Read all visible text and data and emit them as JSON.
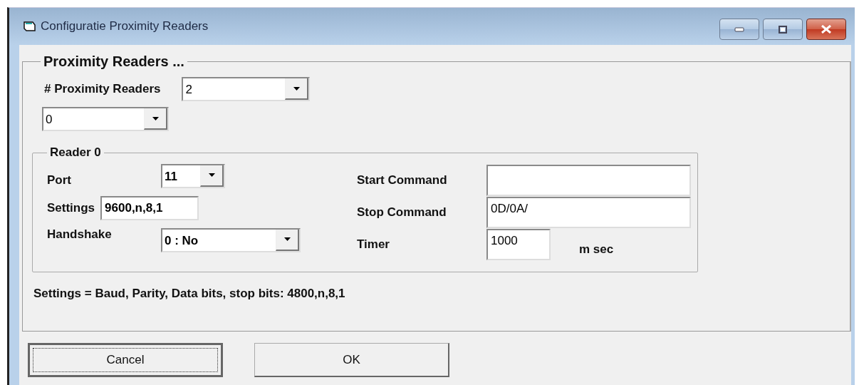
{
  "window": {
    "title": "Configuratie Proximity Readers"
  },
  "group": {
    "title": "Proximity Readers ...",
    "reader_count": {
      "label": "# Proximity Readers",
      "value": "2"
    },
    "reader_select": {
      "value": "0"
    },
    "reader": {
      "title": "Reader 0",
      "port": {
        "label": "Port",
        "value": "11"
      },
      "settings": {
        "label": "Settings",
        "value": "9600,n,8,1"
      },
      "handshake": {
        "label": "Handshake",
        "value": "0 : No"
      },
      "start_command": {
        "label": "Start Command"
      },
      "stop_command": {
        "label": "Stop Command",
        "value": "0D/0A/"
      },
      "timer": {
        "label": "Timer",
        "value": "1000",
        "unit": "m sec"
      }
    },
    "hint": "Settings = Baud, Parity, Data bits, stop bits: 4800,n,8,1"
  },
  "buttons": [
    {
      "label": "Cancel",
      "focused": true
    },
    {
      "label": "OK",
      "focused": false
    }
  ]
}
